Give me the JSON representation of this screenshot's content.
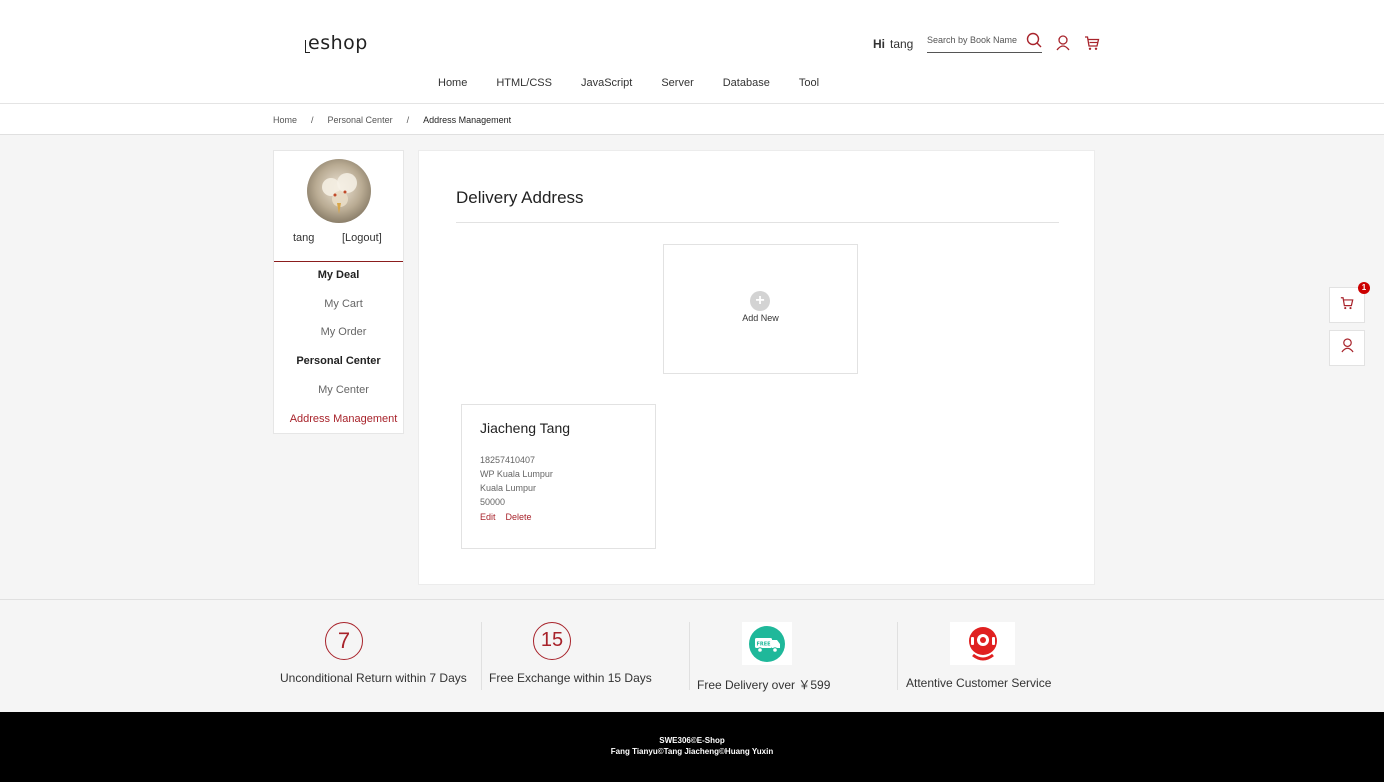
{
  "header": {
    "logo": "eshop",
    "greeting": "Hi",
    "username": "tang",
    "search_placeholder": "Search by Book Name"
  },
  "nav": [
    "Home",
    "HTML/CSS",
    "JavaScript",
    "Server",
    "Database",
    "Tool"
  ],
  "breadcrumb": [
    "Home",
    "Personal Center",
    "Address Management"
  ],
  "sidebar": {
    "username": "tang",
    "logout": "[Logout]",
    "groups": [
      {
        "label": "My Deal",
        "items": [
          "My Cart",
          "My Order"
        ]
      },
      {
        "label": "Personal Center",
        "items": [
          "My Center",
          "Address Management"
        ]
      }
    ],
    "active": "Address Management"
  },
  "main": {
    "title": "Delivery Address",
    "add_new": "Add New",
    "address": {
      "name": "Jiacheng Tang",
      "phone": "18257410407",
      "line1": "WP Kuala Lumpur",
      "line2": "Kuala Lumpur",
      "postcode": "50000",
      "edit": "Edit",
      "delete": "Delete"
    }
  },
  "floating": {
    "cart_count": "1"
  },
  "services": [
    {
      "icon": "7",
      "text": "Unconditional Return within 7 Days"
    },
    {
      "icon": "15",
      "text": "Free Exchange within 15 Days"
    },
    {
      "icon": "free-delivery-truck-icon",
      "text": "Free Delivery over ￥599"
    },
    {
      "icon": "customer-service-icon",
      "text": "Attentive Customer Service"
    }
  ],
  "footer": {
    "line1": "SWE306©E-Shop",
    "line2": "Fang Tianyu©Tang Jiacheng©Huang Yuxin"
  },
  "colors": {
    "accent": "#a8232b",
    "footer_bg": "#000000",
    "teal": "#1fb89a",
    "red": "#e02020"
  }
}
